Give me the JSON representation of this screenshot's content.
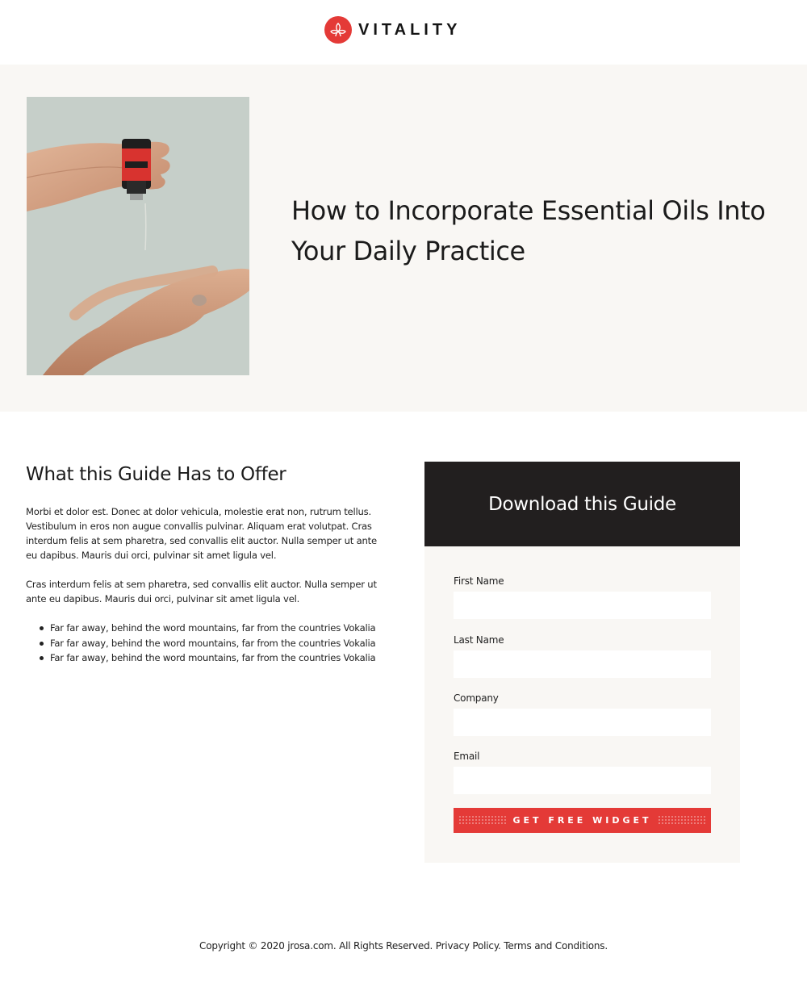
{
  "header": {
    "brand_name": "VITALITY",
    "logo_icon": "lotus-icon",
    "brand_color": "#e43a37"
  },
  "hero": {
    "image_icon": "hands-essential-oil-bottle-photo",
    "title": "How to Incorporate Essential Oils Into Your Daily Practice"
  },
  "content": {
    "heading": "What this Guide Has to Offer",
    "paragraphs": [
      "Morbi et dolor est. Donec at dolor vehicula, molestie erat non, rutrum tellus. Vestibulum in eros non augue convallis pulvinar. Aliquam erat volutpat. Cras interdum felis at sem pharetra, sed convallis elit auctor. Nulla semper ut ante eu dapibus. Mauris dui orci, pulvinar sit amet ligula vel.",
      "Cras interdum felis at sem pharetra, sed convallis elit auctor. Nulla semper ut ante eu dapibus. Mauris dui orci, pulvinar sit amet ligula vel."
    ],
    "bullets": [
      "Far far away, behind the word mountains, far from the countries Vokalia",
      "Far far away, behind the word mountains, far from the countries Vokalia",
      "Far far away, behind the word mountains, far from the countries Vokalia"
    ]
  },
  "form": {
    "title": "Download this Guide",
    "fields": [
      {
        "label": "First Name",
        "value": "",
        "placeholder": ""
      },
      {
        "label": "Last Name",
        "value": "",
        "placeholder": ""
      },
      {
        "label": "Company",
        "value": "",
        "placeholder": ""
      },
      {
        "label": "Email",
        "value": "",
        "placeholder": ""
      }
    ],
    "submit_label": "GET FREE WIDGET",
    "submit_color": "#e43a37",
    "header_color": "#221f1f"
  },
  "footer": {
    "copyright": "Copyright © 2020 jrosa.com. All Rights Reserved.",
    "privacy": "Privacy Policy.",
    "terms": "Terms and Conditions."
  }
}
